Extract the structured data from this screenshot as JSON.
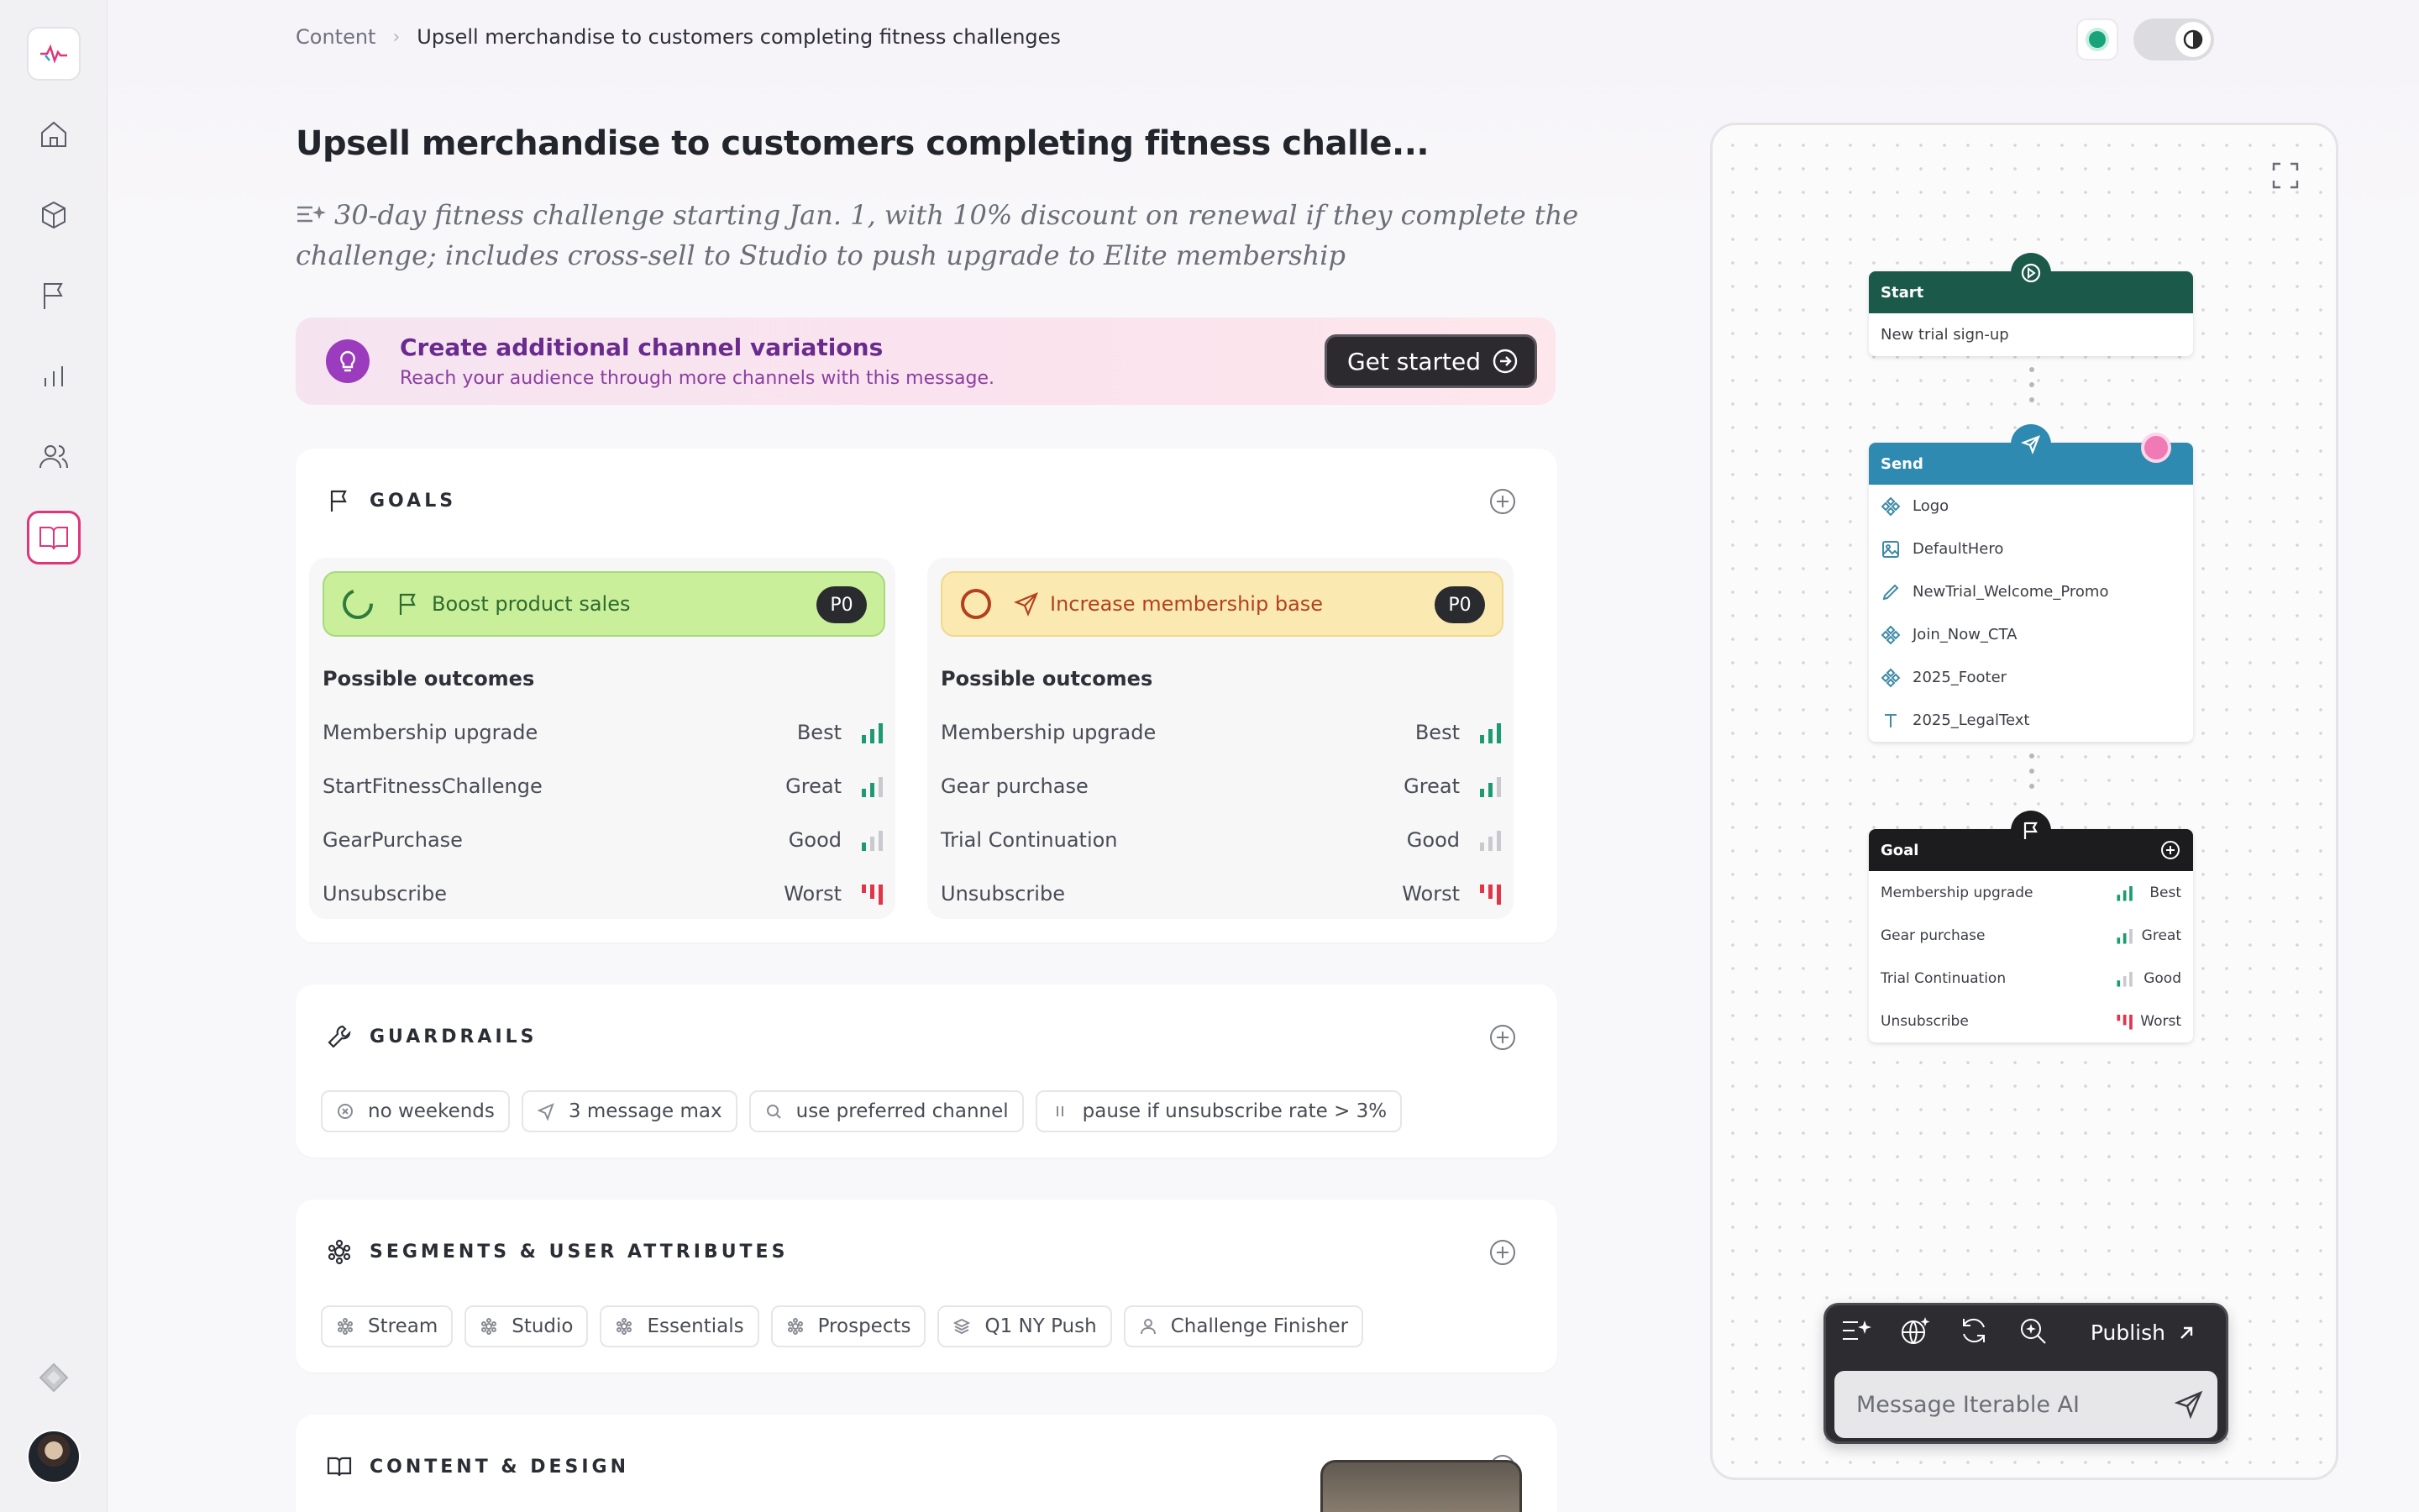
{
  "breadcrumb": {
    "root": "Content",
    "current": "Upsell merchandise to customers completing fitness challenges"
  },
  "page": {
    "title": "Upsell merchandise to customers completing fitness challe...",
    "description": "30-day fitness challenge starting Jan. 1, with 10% discount on renewal if they complete the challenge; includes cross-sell to Studio to push upgrade to Elite membership"
  },
  "banner": {
    "title": "Create additional channel variations",
    "subtitle": "Reach your audience through more channels with this message.",
    "button": "Get started"
  },
  "goals": {
    "heading": "GOALS",
    "possible_outcomes_label": "Possible outcomes",
    "columns": [
      {
        "name": "Boost product sales",
        "priority": "P0",
        "color": "#c9ef9a",
        "border": "#a9d97c",
        "outcomes": [
          {
            "name": "Membership upgrade",
            "rating": "Best"
          },
          {
            "name": "StartFitnessChallenge",
            "rating": "Great"
          },
          {
            "name": "GearPurchase",
            "rating": "Good"
          },
          {
            "name": "Unsubscribe",
            "rating": "Worst"
          }
        ]
      },
      {
        "name": "Increase membership base",
        "priority": "P0",
        "color": "#fbe9b2",
        "border": "#f0d88c",
        "outcomes": [
          {
            "name": "Membership upgrade",
            "rating": "Best"
          },
          {
            "name": "Gear purchase",
            "rating": "Great"
          },
          {
            "name": "Trial Continuation",
            "rating": "Good"
          },
          {
            "name": "Unsubscribe",
            "rating": "Worst"
          }
        ]
      }
    ]
  },
  "guardrails": {
    "heading": "GUARDRAILS",
    "tags": [
      "no weekends",
      "3 message max",
      "use preferred channel",
      "pause if unsubscribe rate > 3%"
    ]
  },
  "segments": {
    "heading": "SEGMENTS & USER ATTRIBUTES",
    "tags": [
      "Stream",
      "Studio",
      "Essentials",
      "Prospects",
      "Q1 NY Push",
      "Challenge Finisher"
    ]
  },
  "content_design": {
    "heading": "CONTENT & DESIGN"
  },
  "flow": {
    "start": {
      "title": "Start",
      "item": "New trial sign-up",
      "color": "#1b5a4b"
    },
    "send": {
      "title": "Send",
      "color": "#2e8ab0",
      "items": [
        "Logo",
        "DefaultHero",
        "NewTrial_Welcome_Promo",
        "Join_Now_CTA",
        "2025_Footer",
        "2025_LegalText"
      ]
    },
    "goal": {
      "title": "Goal",
      "color": "#1c1c1e",
      "items": [
        {
          "name": "Membership upgrade",
          "rating": "Best"
        },
        {
          "name": "Gear purchase",
          "rating": "Great"
        },
        {
          "name": "Trial Continuation",
          "rating": "Good"
        },
        {
          "name": "Unsubscribe",
          "rating": "Worst"
        }
      ]
    }
  },
  "ai": {
    "publish": "Publish",
    "placeholder": "Message Iterable AI"
  },
  "colors": {
    "accent": "#e0357a",
    "good": "#1e9a72",
    "bad": "#e0364a",
    "muted": "#c9c9cf"
  }
}
